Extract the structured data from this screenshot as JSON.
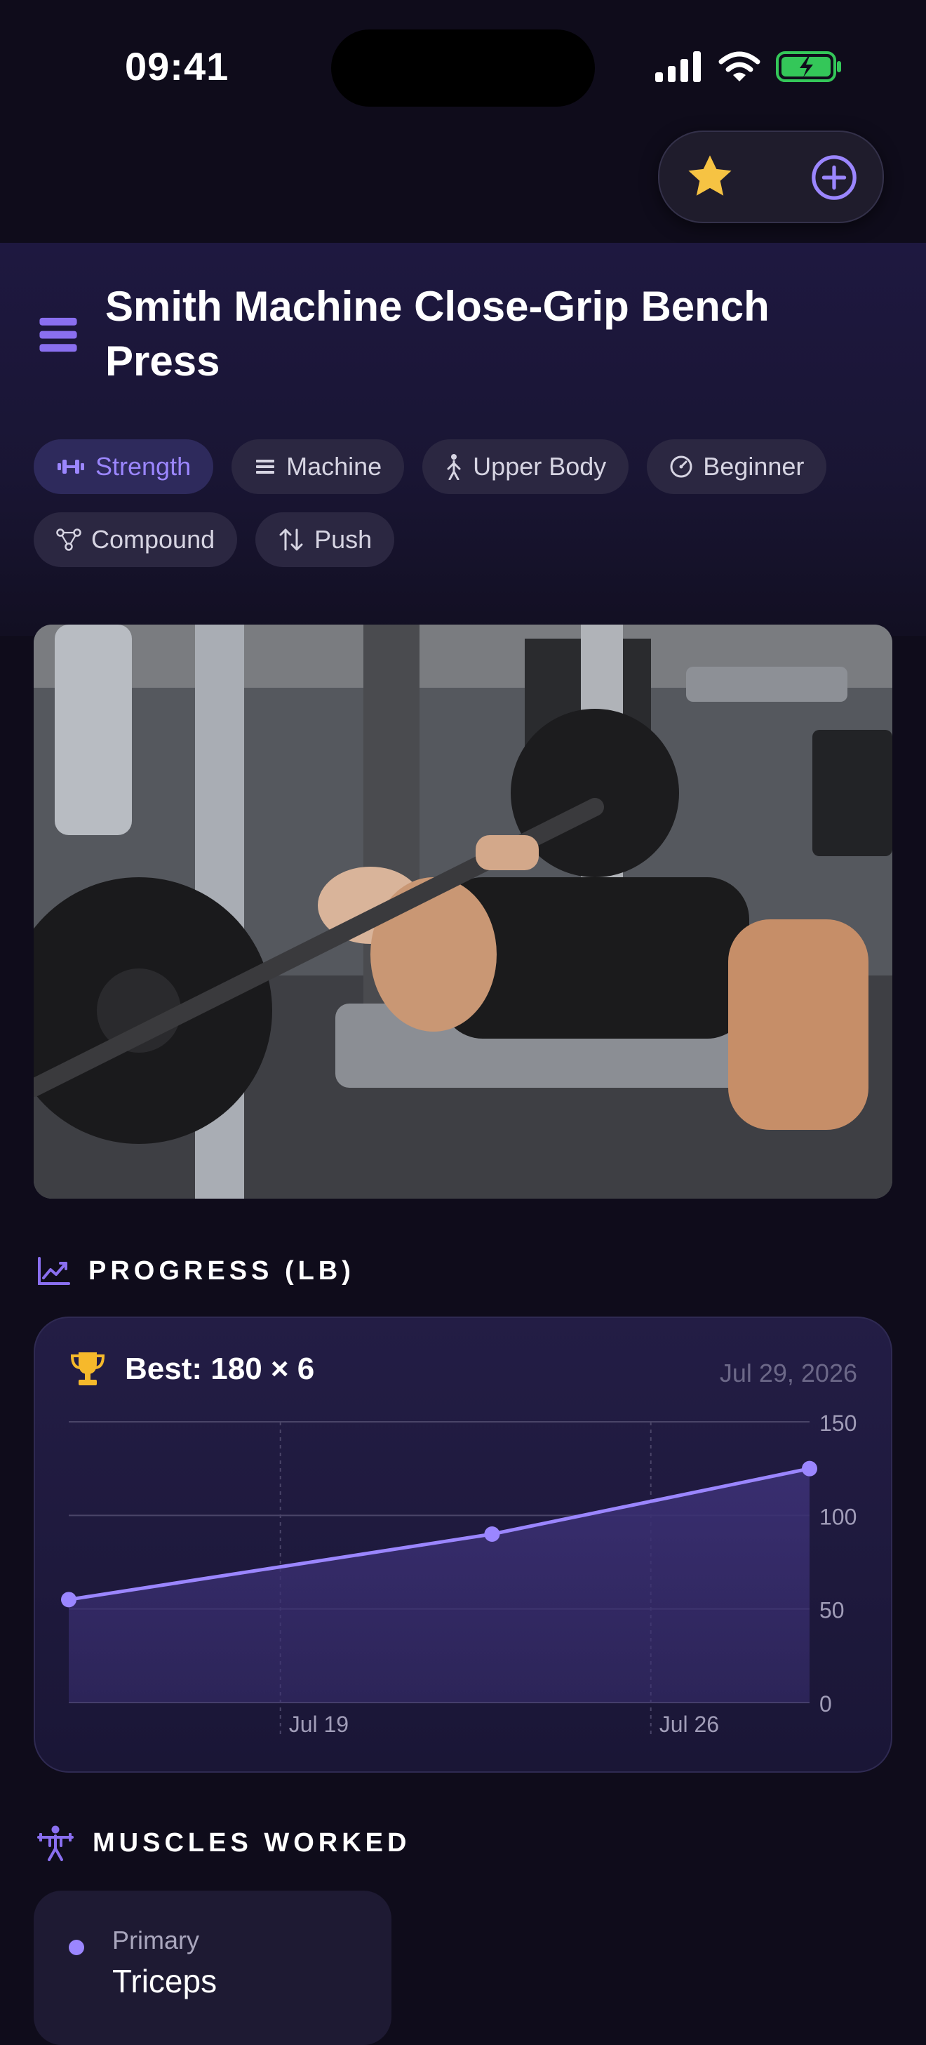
{
  "status_bar": {
    "time": "09:41"
  },
  "exercise": {
    "title": "Smith Machine Close-Grip Bench Press",
    "tags": [
      {
        "label": "Strength",
        "icon": "dumbbell-icon",
        "active": true
      },
      {
        "label": "Machine",
        "icon": "list-icon"
      },
      {
        "label": "Upper Body",
        "icon": "person-icon"
      },
      {
        "label": "Beginner",
        "icon": "gauge-icon"
      },
      {
        "label": "Compound",
        "icon": "nodes-icon"
      },
      {
        "label": "Push",
        "icon": "arrows-updown-icon"
      }
    ]
  },
  "progress": {
    "section_title": "PROGRESS (LB)",
    "best_label": "Best: 180 × 6",
    "best_date": "Jul 29, 2026"
  },
  "chart_data": {
    "type": "area",
    "x": [
      "Jul 15",
      "Jul 23",
      "Jul 29"
    ],
    "y": [
      55,
      90,
      125
    ],
    "x_ticks": [
      "Jul 19",
      "Jul 26"
    ],
    "y_ticks": [
      0,
      50,
      100,
      150
    ],
    "ylim": [
      0,
      150
    ],
    "grid": true,
    "colors": {
      "line": "#9b86ff",
      "fill": "#3a2f72"
    }
  },
  "muscles": {
    "section_title": "MUSCLES WORKED",
    "items": [
      {
        "kind": "Primary",
        "name": "Triceps"
      }
    ]
  },
  "colors": {
    "accent": "#9b86ff",
    "star": "#f6c343",
    "background": "#0f0c1b"
  }
}
